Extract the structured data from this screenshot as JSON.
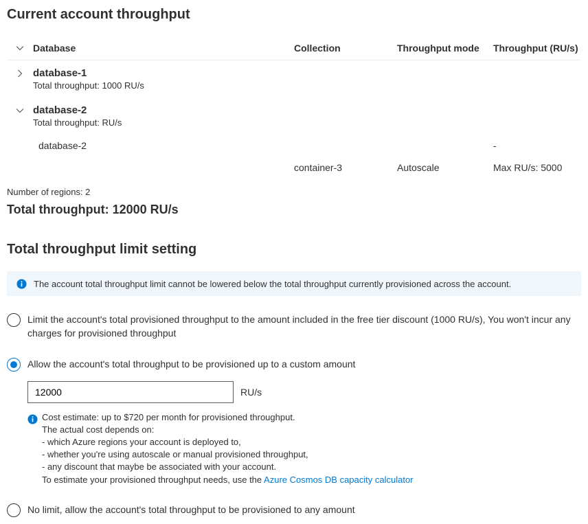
{
  "section1": {
    "title": "Current account throughput",
    "headers": {
      "database": "Database",
      "collection": "Collection",
      "mode": "Throughput mode",
      "throughput": "Throughput (RU/s)"
    },
    "db1": {
      "name": "database-1",
      "subtext": "Total throughput: 1000 RU/s"
    },
    "db2": {
      "name": "database-2",
      "subtext": "Total throughput: RU/s",
      "childName": "database-2",
      "childThroughput": "-",
      "childCollection": "container-3",
      "childMode": "Autoscale",
      "childMaxRus": "Max RU/s: 5000"
    },
    "regions": "Number of regions: 2",
    "total": "Total throughput: 12000 RU/s"
  },
  "section2": {
    "title": "Total throughput limit setting",
    "banner": "The account total throughput limit cannot be lowered below the total throughput currently provisioned across the account.",
    "option1": "Limit the account's total provisioned throughput to the amount included in the free tier discount (1000 RU/s), You won't incur any charges for provisioned throughput",
    "option2": {
      "label": "Allow the account's total throughput to be provisioned up to a custom amount",
      "value": "12000",
      "unit": "RU/s",
      "costTitle": "Cost estimate: up to $720 per month for provisioned throughput.",
      "costLine1": "The actual cost depends on:",
      "costLine2": "- which Azure regions your account is deployed to,",
      "costLine3": "- whether you're using autoscale or manual provisioned throughput,",
      "costLine4": "- any discount that maybe be associated with your account.",
      "costLine5Prefix": "To estimate your provisioned throughput needs, use the ",
      "costLink": "Azure Cosmos DB capacity calculator"
    },
    "option3": "No limit, allow the account's total throughput to be provisioned to any amount"
  }
}
